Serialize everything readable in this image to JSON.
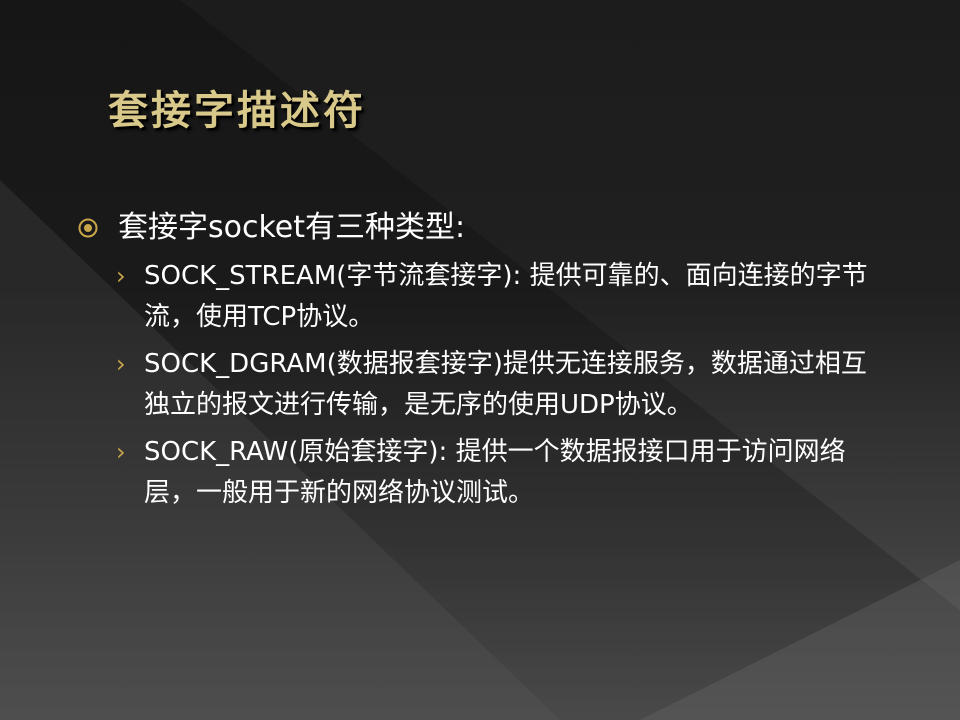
{
  "slide": {
    "title": "套接字描述符",
    "bullet": {
      "text": "套接字socket有三种类型:",
      "icon": "circle-dot-bullet-icon"
    },
    "sub_bullets": [
      {
        "text": "SOCK_STREAM(字节流套接字): 提供可靠的、面向连接的字节流，使用TCP协议。"
      },
      {
        "text": "SOCK_DGRAM(数据报套接字)提供无连接服务，数据通过相互独立的报文进行传输，是无序的使用UDP协议。"
      },
      {
        "text": "SOCK_RAW(原始套接字): 提供一个数据报接口用于访问网络层，一般用于新的网络协议测试。"
      }
    ],
    "sub_bullet_glyph": "›",
    "colors": {
      "title": "#d8c88a",
      "bullet_accent": "#c9a64a",
      "text": "#ffffff"
    }
  }
}
